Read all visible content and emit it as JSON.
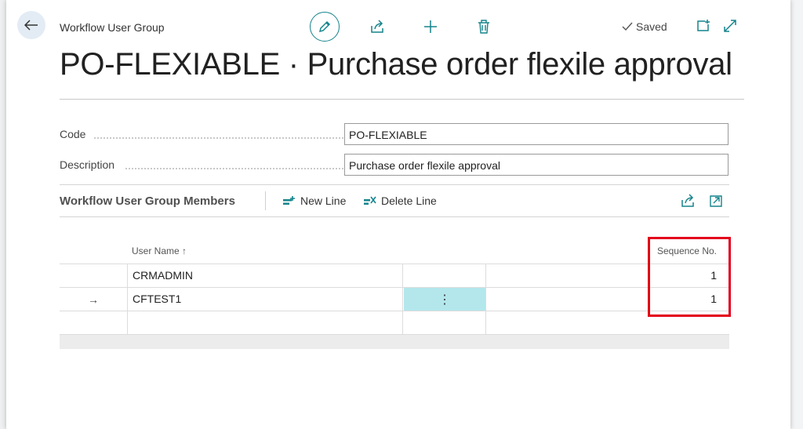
{
  "header": {
    "caption": "Workflow User Group",
    "status": "Saved",
    "title": "PO-FLEXIABLE · Purchase order flexile approval"
  },
  "fields": {
    "code": {
      "label": "Code",
      "value": "PO-FLEXIABLE"
    },
    "description": {
      "label": "Description",
      "value": "Purchase order flexile approval"
    }
  },
  "subpage": {
    "title": "Workflow User Group Members",
    "new_line": "New Line",
    "delete_line": "Delete Line",
    "columns": {
      "user_name": "User Name ↑",
      "sequence_no": "Sequence No."
    },
    "rows": [
      {
        "indicator": "",
        "user_name": "CRMADMIN",
        "sequence_no": "1"
      },
      {
        "indicator": "→",
        "user_name": "CFTEST1",
        "sequence_no": "1"
      },
      {
        "indicator": "",
        "user_name": "",
        "sequence_no": ""
      }
    ]
  },
  "colors": {
    "accent": "#15848c",
    "highlight": "#e3001b",
    "selected_cell": "#b3e7ec"
  }
}
